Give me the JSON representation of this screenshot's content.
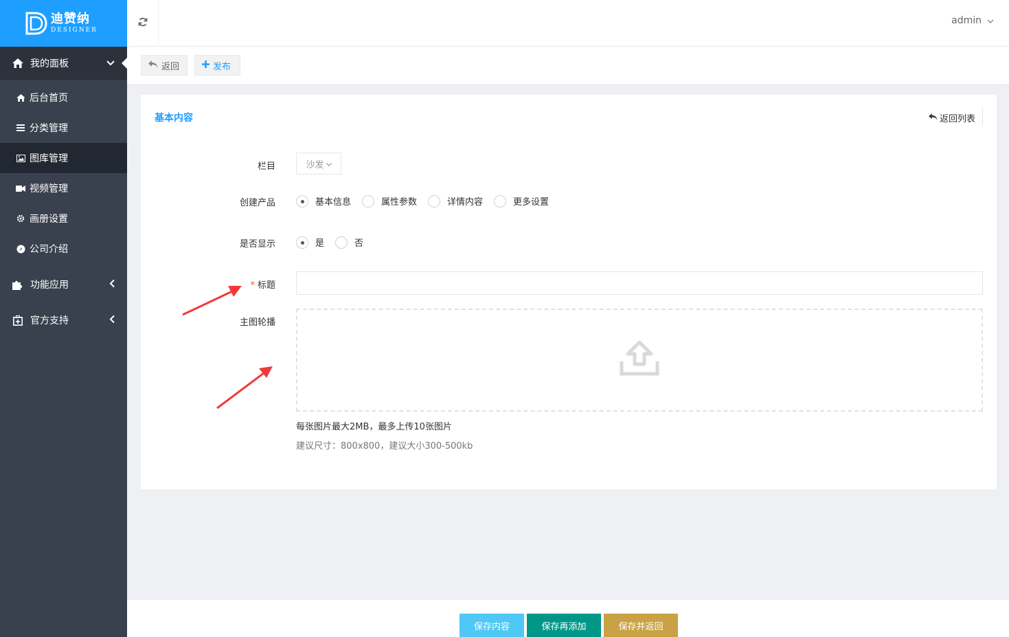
{
  "brand": {
    "name_cn": "迪赞纳",
    "name_en": "DESIGNER",
    "color": "#1e9fff"
  },
  "header": {
    "refresh_icon": "refresh-icon",
    "user": "admin"
  },
  "sidebar": {
    "dashboard": {
      "label": "我的面板",
      "icon": "home-icon",
      "items": [
        {
          "label": "后台首页",
          "icon": "home-icon"
        },
        {
          "label": "分类管理",
          "icon": "list-icon"
        },
        {
          "label": "图库管理",
          "icon": "image-icon"
        },
        {
          "label": "视频管理",
          "icon": "video-icon"
        },
        {
          "label": "画册设置",
          "icon": "gear-icon"
        },
        {
          "label": "公司介绍",
          "icon": "compass-icon"
        }
      ]
    },
    "features": {
      "label": "功能应用",
      "icon": "puzzle-icon"
    },
    "support": {
      "label": "官方支持",
      "icon": "plus-box-icon"
    }
  },
  "toolbar": {
    "back_label": "返回",
    "publish_label": "发布"
  },
  "card": {
    "title": "基本内容",
    "back_list_label": "返回列表"
  },
  "form": {
    "column_label": "栏目",
    "column_value": "沙发",
    "create_label": "创建产品",
    "create_options": [
      "基本信息",
      "属性参数",
      "详情内容",
      "更多设置"
    ],
    "create_selected": "基本信息",
    "display_label": "是否显示",
    "display_options": [
      "是",
      "否"
    ],
    "display_selected": "是",
    "required_mark": "*",
    "title_label": "标题",
    "title_value": "",
    "carousel_label": "主图轮播",
    "upload_hint1": "每张图片最大2MB，最多上传10张图片",
    "upload_hint2": "建议尺寸：800x800，建议大小300-500kb"
  },
  "footer": {
    "save_label": "保存内容",
    "save_add_label": "保存再添加",
    "save_back_label": "保存并返回",
    "colors": {
      "save": "#4fc8f5",
      "save_add": "#009688",
      "save_back": "#c9a245"
    }
  }
}
